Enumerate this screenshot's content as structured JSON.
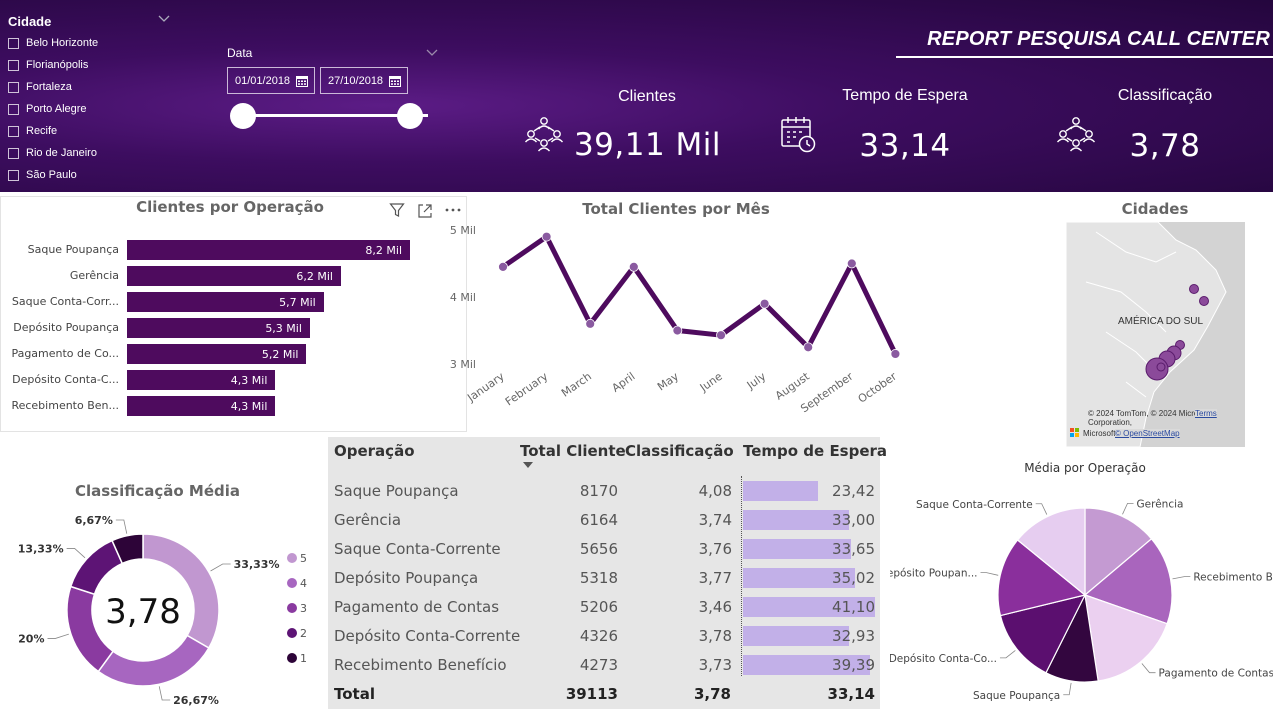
{
  "header": {
    "report_title": "REPORT PESQUISA CALL CENTER"
  },
  "slicer_cidade": {
    "title": "Cidade",
    "items": [
      "Belo Horizonte",
      "Florianópolis",
      "Fortaleza",
      "Porto Alegre",
      "Recife",
      "Rio de Janeiro",
      "São Paulo"
    ]
  },
  "slicer_data": {
    "title": "Data",
    "start": "01/01/2018",
    "end": "27/10/2018",
    "range_fraction": [
      0,
      1
    ]
  },
  "kpis": [
    {
      "label": "Clientes",
      "value": "39,11 Mil",
      "icon": "people-network-icon"
    },
    {
      "label": "Tempo de Espera",
      "value": "33,14",
      "icon": "calendar-clock-icon"
    },
    {
      "label": "Classificação",
      "value": "3,78",
      "icon": "people-network-icon"
    }
  ],
  "bar_panel": {
    "title": "Clientes por Operação"
  },
  "line_panel": {
    "title": "Total Clientes por Mês"
  },
  "map_panel": {
    "title": "Cidades",
    "region_label": "AMÉRICA DO SUL",
    "attribution": "© 2024 TomTom, © 2024 Microsoft Corporation,",
    "attribution_link": "© OpenStreetMap",
    "terms": "Terms",
    "brand": "Microsoft"
  },
  "donut_panel": {
    "title": "Classificação Média",
    "center_value": "3,78"
  },
  "pie_panel": {
    "title": "Média por Operação"
  },
  "table": {
    "headers": [
      "Operação",
      "Total Cliente",
      "Classificação",
      "Tempo de Espera"
    ],
    "rows": [
      {
        "op": "Saque Poupança",
        "total": "8170",
        "class": "4,08",
        "tempo": "23,42",
        "tempo_num": 23.42
      },
      {
        "op": "Gerência",
        "total": "6164",
        "class": "3,74",
        "tempo": "33,00",
        "tempo_num": 33.0
      },
      {
        "op": "Saque Conta-Corrente",
        "total": "5656",
        "class": "3,76",
        "tempo": "33,65",
        "tempo_num": 33.65
      },
      {
        "op": "Depósito Poupança",
        "total": "5318",
        "class": "3,77",
        "tempo": "35,02",
        "tempo_num": 35.02
      },
      {
        "op": "Pagamento de Contas",
        "total": "5206",
        "class": "3,46",
        "tempo": "41,10",
        "tempo_num": 41.1
      },
      {
        "op": "Depósito Conta-Corrente",
        "total": "4326",
        "class": "3,78",
        "tempo": "32,93",
        "tempo_num": 32.93
      },
      {
        "op": "Recebimento Benefício",
        "total": "4273",
        "class": "3,73",
        "tempo": "39,39",
        "tempo_num": 39.39
      }
    ],
    "total": {
      "label": "Total",
      "total": "39113",
      "class": "3,78",
      "tempo": "33,14"
    }
  },
  "colors": {
    "accent": "#4e0b5e",
    "banner": "#3d0d60",
    "table_bar": "#c2b0e8"
  },
  "chart_data": [
    {
      "type": "bar",
      "title": "Clientes por Operação",
      "categories": [
        "Saque Poupança",
        "Gerência",
        "Saque Conta-Corr...",
        "Depósito Poupança",
        "Pagamento de Co...",
        "Depósito Conta-C...",
        "Recebimento Ben..."
      ],
      "values": [
        8.2,
        6.2,
        5.7,
        5.3,
        5.2,
        4.3,
        4.3
      ],
      "data_labels": [
        "8,2 Mil",
        "6,2 Mil",
        "5,7 Mil",
        "5,3 Mil",
        "5,2 Mil",
        "4,3 Mil",
        "4,3 Mil"
      ],
      "orientation": "horizontal"
    },
    {
      "type": "line",
      "title": "Total Clientes por Mês",
      "x": [
        "January",
        "February",
        "March",
        "April",
        "May",
        "June",
        "July",
        "August",
        "September",
        "October"
      ],
      "y": [
        4.45,
        4.9,
        3.6,
        4.45,
        3.5,
        3.43,
        3.9,
        3.25,
        4.5,
        3.15
      ],
      "ylim": [
        3,
        5
      ],
      "yticks": [
        "5 Mil",
        "4 Mil",
        "3 Mil"
      ],
      "ytick_values": [
        5,
        4,
        3
      ]
    },
    {
      "type": "pie",
      "title": "Classificação Média",
      "donut": true,
      "categories": [
        "5",
        "4",
        "3",
        "2",
        "1"
      ],
      "values": [
        33.33,
        26.67,
        20,
        13.33,
        6.67
      ],
      "data_labels": [
        "33,33%",
        "26,67%",
        "20%",
        "13,33%",
        "6,67%"
      ],
      "colors": [
        "#c197d0",
        "#a766c0",
        "#8a3aa0",
        "#5d1475",
        "#2d0438"
      ],
      "legend": "right"
    },
    {
      "type": "pie",
      "title": "Média por Operação",
      "categories": [
        "Gerência",
        "Recebimento Be...",
        "Pagamento de Contas",
        "Saque Poupança",
        "Depósito Conta-Co...",
        "Depósito Poupan...",
        "Saque Conta-Corrente"
      ],
      "values": [
        33.0,
        39.39,
        41.1,
        23.42,
        32.93,
        35.02,
        33.65
      ],
      "colors": [
        "#c49ad2",
        "#a965bd",
        "#ebd0f0",
        "#33063f",
        "#5b0f6f",
        "#8a2f9c",
        "#e6cdf0"
      ]
    }
  ]
}
